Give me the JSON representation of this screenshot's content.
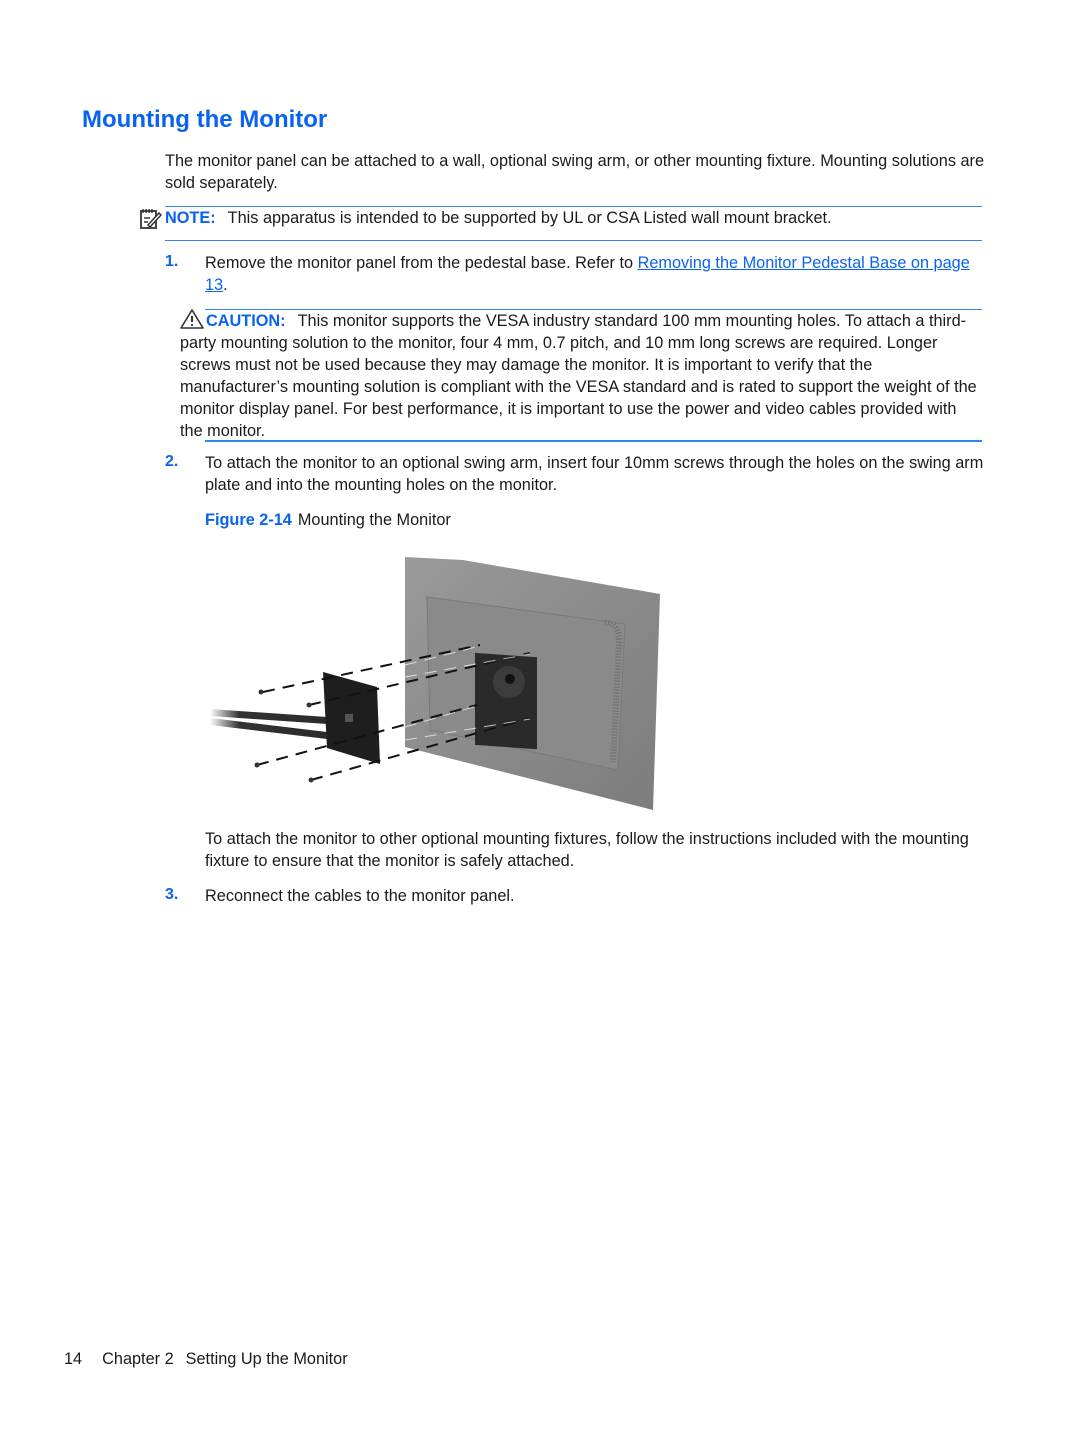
{
  "page": {
    "heading": "Mounting the Monitor",
    "intro": "The monitor panel can be attached to a wall, optional swing arm, or other mounting fixture. Mounting solutions are sold separately.",
    "note": {
      "icon": "note-pencil-icon",
      "label": "NOTE:",
      "text": "This apparatus is intended to be supported by UL or CSA Listed wall mount bracket."
    },
    "steps": [
      {
        "number": "1.",
        "text_before": "Remove the monitor panel from the pedestal base. Refer to ",
        "link": "Removing the Monitor Pedestal Base on page 13",
        "text_after": "."
      },
      {
        "number": "2.",
        "text": "To attach the monitor to an optional swing arm, insert four 10mm screws through the holes on the swing arm plate and into the mounting holes on the monitor."
      },
      {
        "number": "3.",
        "text": "Reconnect the cables to the monitor panel."
      }
    ],
    "caution": {
      "icon": "warning-triangle-icon",
      "label": "CAUTION:",
      "text": "This monitor supports the VESA industry standard 100 mm mounting holes. To attach a third-party mounting solution to the monitor, four 4 mm, 0.7 pitch, and 10 mm long screws are required. Longer screws must not be used because they may damage the monitor. It is important to verify that the manufacturer’s mounting solution is compliant with the VESA standard and is rated to support the weight of the monitor display panel. For best performance, it is important to use the power and video cables provided with the monitor."
    },
    "figure": {
      "label": "Figure 2-14",
      "caption": "Mounting the Monitor",
      "alt": "Illustration of swing arm plate attached to the back of a monitor with four screws"
    },
    "after_figure": "To attach the monitor to other optional mounting fixtures, follow the instructions included with the mounting fixture to ensure that the monitor is safely attached.",
    "footer": {
      "page_number": "14",
      "chapter": "Chapter 2",
      "chapter_title": "Setting Up the Monitor"
    }
  },
  "colors": {
    "accent": "#0a63f0",
    "rule": "#2f86f0",
    "text": "#1a1a1a"
  }
}
